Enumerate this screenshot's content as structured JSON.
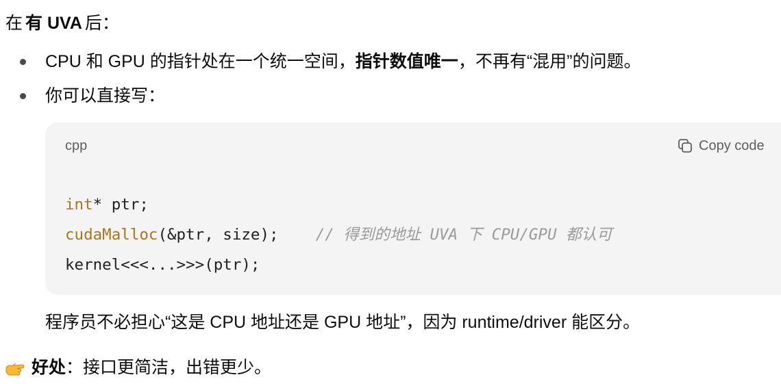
{
  "intro": {
    "prefix": "在",
    "bold": "有 UVA",
    "suffix": "后："
  },
  "bullets": [
    {
      "before": "CPU 和 GPU 的指针处在一个统一空间，",
      "bold": "指针数值唯一",
      "after": "，不再有“混用”的问题。"
    },
    {
      "text": "你可以直接写："
    }
  ],
  "code_block": {
    "language": "cpp",
    "copy_label": "Copy code",
    "lines": {
      "l1_type": "int",
      "l1_rest": "* ptr;",
      "l2_fn": "cudaMalloc",
      "l2_rest": "(&ptr, size);    ",
      "l2_comment": "// 得到的地址 UVA 下 CPU/GPU 都认可",
      "l3": "kernel<<<...>>>(ptr);"
    }
  },
  "after_text": "程序员不必担心“这是 CPU 地址还是 GPU 地址”，因为 runtime/driver 能区分。",
  "benefit": {
    "icon": "pointing-hand-icon",
    "bold": "好处",
    "text": "：接口更简洁，出错更少。"
  }
}
